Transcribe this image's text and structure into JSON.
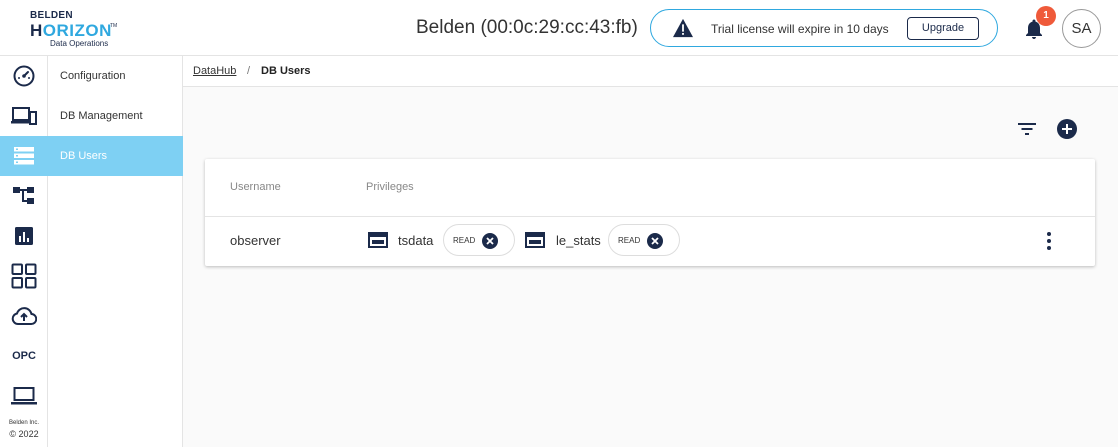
{
  "logo": {
    "brand": "BELDEN",
    "product_main": "H",
    "product_accent": "ORIZON",
    "trademark": "TM",
    "tagline": "Data Operations"
  },
  "header": {
    "device_title": "Belden (00:0c:29:cc:43:fb)",
    "license_message": "Trial license will expire in 10 days",
    "upgrade_label": "Upgrade",
    "notification_count": "1",
    "avatar_initials": "SA"
  },
  "rail": {
    "icons": [
      "dashboard-icon",
      "devices-icon",
      "storage-icon",
      "hierarchy-icon",
      "analytics-icon",
      "apps-grid-icon",
      "cloud-upload-icon",
      "opc-icon",
      "laptop-icon"
    ],
    "opc_label": "OPC",
    "footer_company": "Belden Inc.",
    "footer_year": "© 2022"
  },
  "subnav": {
    "items": [
      {
        "label": "Configuration"
      },
      {
        "label": "DB Management"
      },
      {
        "label": "DB Users"
      }
    ]
  },
  "breadcrumb": {
    "parent": "DataHub",
    "separator": "/",
    "current": "DB Users"
  },
  "table": {
    "columns": [
      "Username",
      "Privileges"
    ],
    "rows": [
      {
        "username": "observer",
        "privileges": [
          {
            "db": "tsdata",
            "access": "READ"
          },
          {
            "db": "le_stats",
            "access": "READ"
          }
        ]
      }
    ]
  },
  "colors": {
    "accent": "#2fa8df",
    "active_nav": "#7ed0f3",
    "navy": "#1b2a4a",
    "badge": "#ef5a3a"
  }
}
